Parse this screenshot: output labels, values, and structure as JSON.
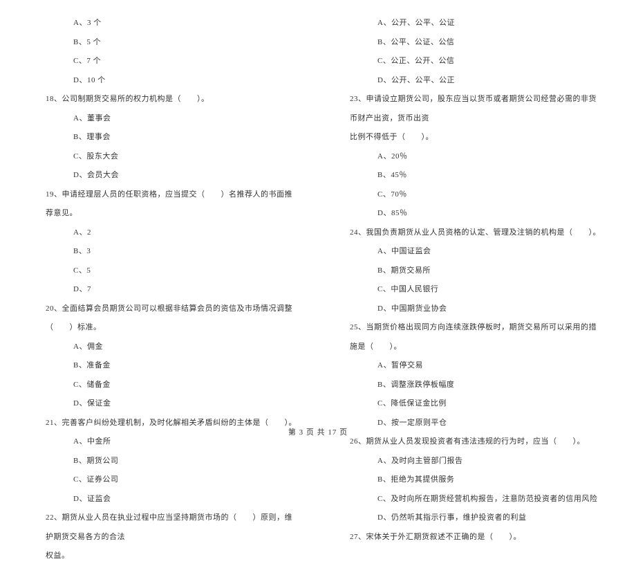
{
  "left_column": {
    "q17_options": [
      "A、3 个",
      "B、5 个",
      "C、7 个",
      "D、10 个"
    ],
    "q18": "18、公司制期货交易所的权力机构是（　　）。",
    "q18_options": [
      "A、董事会",
      "B、理事会",
      "C、股东大会",
      "D、会员大会"
    ],
    "q19": "19、申请经理层人员的任职资格，应当提交（　　）名推荐人的书面推荐意见。",
    "q19_options": [
      "A、2",
      "B、3",
      "C、5",
      "D、7"
    ],
    "q20": "20、全面结算会员期货公司可以根据非结算会员的资信及市场情况调整（　　）标准。",
    "q20_options": [
      "A、佣金",
      "B、准备金",
      "C、储备金",
      "D、保证金"
    ],
    "q21": "21、完善客户纠纷处理机制，及时化解相关矛盾纠纷的主体是（　　）。",
    "q21_options": [
      "A、中金所",
      "B、期货公司",
      "C、证券公司",
      "D、证监会"
    ],
    "q22_line1": "22、期货从业人员在执业过程中应当坚持期货市场的（　　）原则，维护期货交易各方的合法",
    "q22_line2": "权益。"
  },
  "right_column": {
    "q22_options": [
      "A、公开、公平、公证",
      "B、公平、公证、公信",
      "C、公正、公开、公信",
      "D、公开、公平、公正"
    ],
    "q23_line1": "23、申请设立期货公司，股东应当以货币或者期货公司经营必需的非货币财产出资，货币出资",
    "q23_line2": "比例不得低于（　　）。",
    "q23_options": [
      "A、20％",
      "B、45％",
      "C、70％",
      "D、85％"
    ],
    "q24": "24、我国负责期货从业人员资格的认定、管理及注销的机构是（　　）。",
    "q24_options": [
      "A、中国证监会",
      "B、期货交易所",
      "C、中国人民银行",
      "D、中国期货业协会"
    ],
    "q25": "25、当期货价格出现同方向连续涨跌停板时，期货交易所可以采用的措施是（　　）。",
    "q25_options": [
      "A、暂停交易",
      "B、调整涨跌停板幅度",
      "C、降低保证金比例",
      "D、按一定原则平仓"
    ],
    "q26": "26、期货从业人员发现投资者有违法违规的行为时，应当（　　）。",
    "q26_options": [
      "A、及时向主管部门报告",
      "B、拒绝为其提供服务",
      "C、及时向所在期货经营机构报告，注意防范投资者的信用风险",
      "D、仍然听其指示行事，维护投资者的利益"
    ],
    "q27": "27、宋体关于外汇期货叙述不正确的是（　　）。"
  },
  "footer": "第 3 页 共 17 页"
}
